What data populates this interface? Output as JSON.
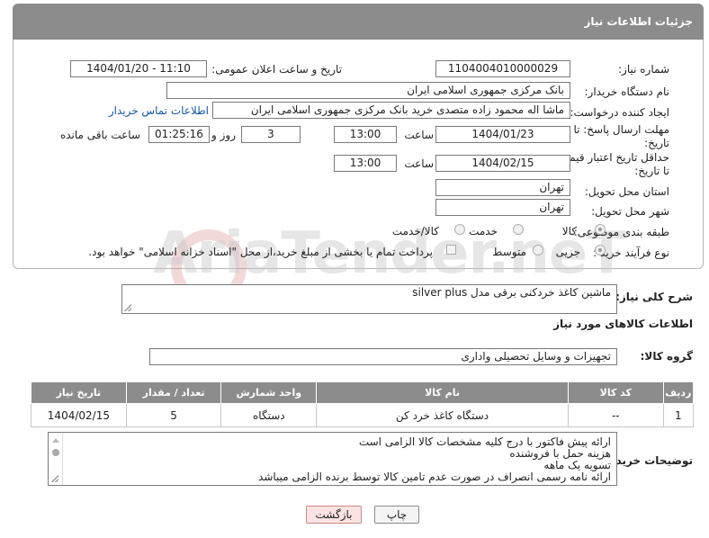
{
  "header": {
    "title": "جزئیات اطلاعات نیاز"
  },
  "fields": {
    "need_number_label": "شماره نیاز:",
    "need_number": "1104004010000029",
    "announce_label": "تاریخ و ساعت اعلان عمومی:",
    "announce_value": "1404/01/20 - 11:10",
    "buyer_org_label": "نام دستگاه خریدار:",
    "buyer_org": "بانک مرکزی جمهوری اسلامی ایران",
    "creator_label": "ایجاد کننده درخواست:",
    "creator": "ماشا اله محمود زاده متصدی خرید بانک مرکزی جمهوری اسلامی ایران",
    "contact_link": "اطلاعات تماس خریدار",
    "deadline_label_1": "مهلت ارسال پاسخ: تا",
    "deadline_label_2": "تاریخ:",
    "deadline_date": "1404/01/23",
    "time_label": "ساعت",
    "deadline_time": "13:00",
    "days_value": "3",
    "days_label": "روز و",
    "remaining_time": "01:25:16",
    "remaining_label": "ساعت باقی مانده",
    "min_price_label_1": "حداقل تاریخ اعتبار قیمت:",
    "min_price_label_2": "تا تاریخ:",
    "validity_date": "1404/02/15",
    "validity_time": "13:00",
    "province_label": "استان محل تحویل:",
    "province": "تهران",
    "city_label": "شهر محل تحویل:",
    "city": "تهران",
    "category_label": "طبقه بندی موضوعی:",
    "category_options": [
      "کالا",
      "خدمت",
      "کالا/خدمت"
    ],
    "process_label": "نوع فرآیند خرید :",
    "process_options": [
      "جزیی",
      "متوسط"
    ],
    "payment_note": "پرداخت تمام یا بخشی از مبلغ خرید،از محل \"اسناد خزانه اسلامی\" خواهد بود."
  },
  "description": {
    "label": "شرح کلی نیاز:",
    "value": "ماشین کاغذ خردکنی برقی مدل silver plus"
  },
  "goods_section": {
    "title": "اطلاعات کالاهای مورد نیاز",
    "group_label": "گروه کالا:",
    "group_value": "تجهیزات و وسایل تحصیلی واداری"
  },
  "table": {
    "headers": [
      "ردیف",
      "کد کالا",
      "نام کالا",
      "واحد شمارش",
      "تعداد / مقدار",
      "تاریخ نیاز"
    ],
    "rows": [
      [
        "1",
        "--",
        "دستگاه کاغذ خرد کن",
        "دستگاه",
        "5",
        "1404/02/15"
      ]
    ]
  },
  "buyer_notes": {
    "label": "توضیحات خریدار:",
    "lines": [
      "ارائه پیش فاکتور با درج کلیه مشخصات کالا الزامی است",
      "هزینه حمل با فروشنده",
      "تسویه یک ماهه",
      "ارائه نامه رسمی انصراف در صورت عدم تامین کالا توسط برنده الزامی میباشد"
    ]
  },
  "buttons": {
    "print": "چاپ",
    "back": "بازگشت"
  },
  "watermark": "AriaTender.neT",
  "colors": {
    "header_bg": "#8c8c8c",
    "link": "#1a55a8",
    "back_button_bg": "#fbe3e3"
  }
}
